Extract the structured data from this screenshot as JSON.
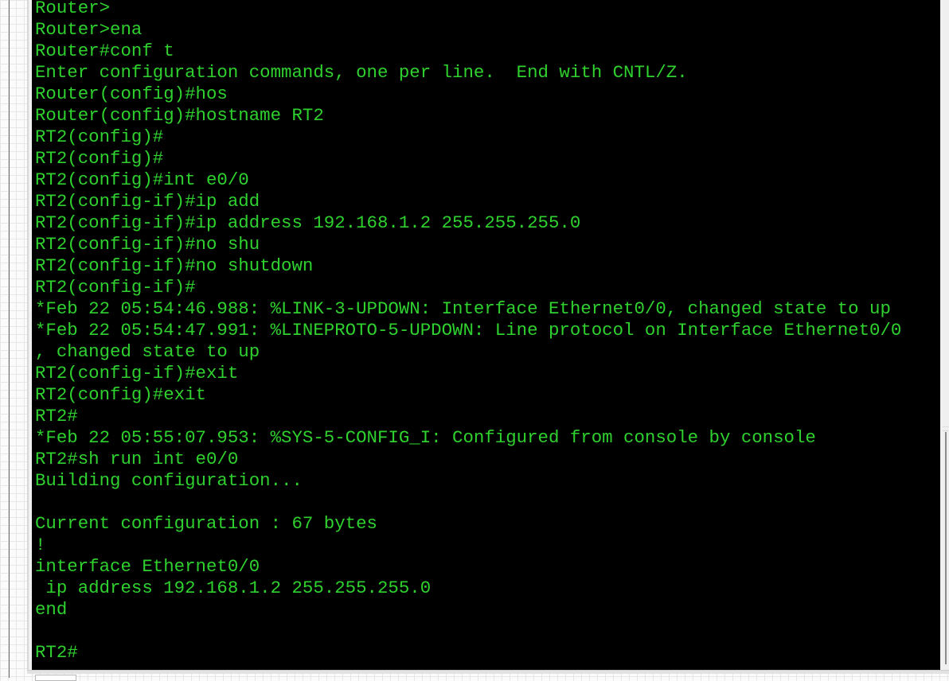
{
  "terminal": {
    "theme": {
      "background": "#000000",
      "foreground": "#2fd12f"
    },
    "lines": [
      "Router>",
      "Router>ena",
      "Router#conf t",
      "Enter configuration commands, one per line.  End with CNTL/Z.",
      "Router(config)#hos",
      "Router(config)#hostname RT2",
      "RT2(config)#",
      "RT2(config)#",
      "RT2(config)#int e0/0",
      "RT2(config-if)#ip add",
      "RT2(config-if)#ip address 192.168.1.2 255.255.255.0",
      "RT2(config-if)#no shu",
      "RT2(config-if)#no shutdown",
      "RT2(config-if)#",
      "*Feb 22 05:54:46.988: %LINK-3-UPDOWN: Interface Ethernet0/0, changed state to up",
      "*Feb 22 05:54:47.991: %LINEPROTO-5-UPDOWN: Line protocol on Interface Ethernet0/0",
      ", changed state to up",
      "RT2(config-if)#exit",
      "RT2(config)#exit",
      "RT2#",
      "*Feb 22 05:55:07.953: %SYS-5-CONFIG_I: Configured from console by console",
      "RT2#sh run int e0/0",
      "Building configuration...",
      "",
      "Current configuration : 67 bytes",
      "!",
      "interface Ethernet0/0",
      " ip address 192.168.1.2 255.255.255.0",
      "end",
      "",
      "RT2#"
    ]
  }
}
